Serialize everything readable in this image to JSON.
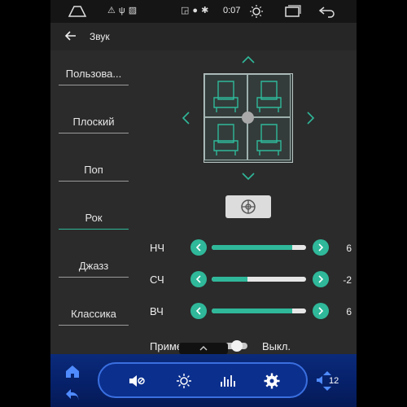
{
  "status_bar": {
    "time": "0:07"
  },
  "header": {
    "title": "Звук"
  },
  "presets": [
    {
      "label": "Пользова..."
    },
    {
      "label": "Плоский"
    },
    {
      "label": "Поп"
    },
    {
      "label": "Рок"
    },
    {
      "label": "Джазз"
    },
    {
      "label": "Классика"
    }
  ],
  "equalizer": [
    {
      "label": "НЧ",
      "value": "6",
      "level": 0.85
    },
    {
      "label": "СЧ",
      "value": "-2",
      "level": 0.38
    },
    {
      "label": "ВЧ",
      "value": "6",
      "level": 0.85
    }
  ],
  "apply_setting": {
    "label": "Приме",
    "state_label": "Выкл."
  },
  "dock": {
    "volume_level": "12"
  },
  "colors": {
    "accent": "#2fb89a",
    "dock": "#0a2a7a"
  }
}
